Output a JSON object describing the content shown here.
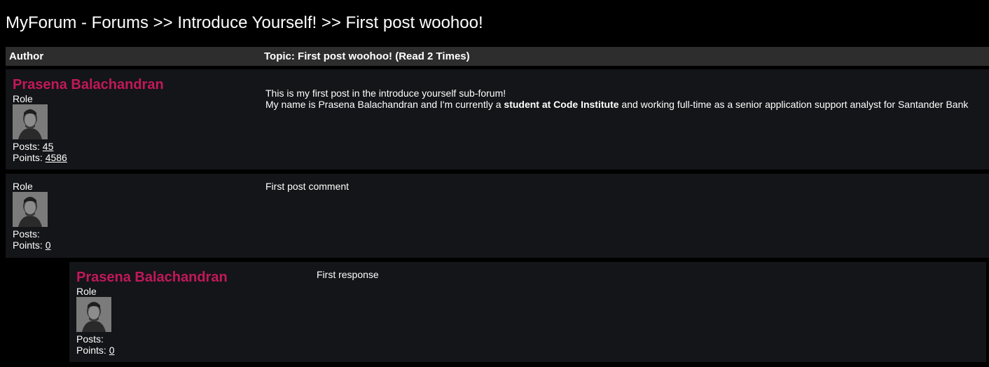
{
  "breadcrumb": "MyForum - Forums >> Introduce Yourself! >> First post woohoo!",
  "header": {
    "author_label": "Author",
    "topic_label": "Topic: First post woohoo! (Read 2 Times)"
  },
  "colors": {
    "author_name": "#c2185b",
    "post_bg": "#141518",
    "header_bg": "#2d2d2d",
    "page_bg": "#000000"
  },
  "posts": [
    {
      "author_name": "Prasena Balachandran",
      "role": "Role",
      "posts_label": "Posts:",
      "posts_value": "45",
      "points_label": "Points:",
      "points_value": "4586",
      "avatar_icon": "avatar-photo-icon",
      "body_line1": "This is my first post in the introduce yourself sub-forum!",
      "body_line2_pre": "My name is Prasena Balachandran and I'm currently a ",
      "body_line2_bold": "student at Code Institute",
      "body_line2_post": " and working full-time as a senior application support analyst for Santander Bank"
    },
    {
      "role": "Role",
      "posts_label": "Posts:",
      "points_label": "Points:",
      "points_value": "0",
      "avatar_icon": "avatar-photo-icon",
      "body": "First post comment"
    },
    {
      "author_name": "Prasena Balachandran",
      "role": "Role",
      "posts_label": "Posts:",
      "points_label": "Points:",
      "points_value": "0",
      "avatar_icon": "avatar-photo-icon",
      "body": "First response"
    }
  ]
}
